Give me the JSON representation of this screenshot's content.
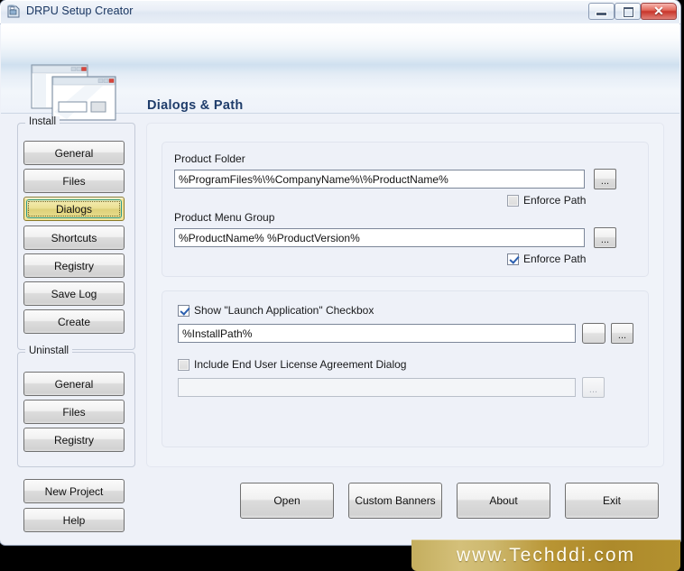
{
  "window": {
    "title": "DRPU Setup Creator",
    "app_icon": "setup-app-icon",
    "controls": {
      "minimize": "minimize-icon",
      "maximize": "maximize-icon",
      "close": "✕"
    }
  },
  "banner": {
    "title": "Dialogs & Path",
    "artwork": "dialog-windows-illustration"
  },
  "sidebar": {
    "install": {
      "legend": "Install",
      "items": [
        {
          "label": "General",
          "selected": false
        },
        {
          "label": "Files",
          "selected": false
        },
        {
          "label": "Dialogs",
          "selected": true
        },
        {
          "label": "Shortcuts",
          "selected": false
        },
        {
          "label": "Registry",
          "selected": false
        },
        {
          "label": "Save Log",
          "selected": false
        },
        {
          "label": "Create",
          "selected": false
        }
      ]
    },
    "uninstall": {
      "legend": "Uninstall",
      "items": [
        {
          "label": "General"
        },
        {
          "label": "Files"
        },
        {
          "label": "Registry"
        }
      ]
    },
    "extra": [
      {
        "label": "New Project"
      },
      {
        "label": "Help"
      }
    ]
  },
  "main": {
    "paths": {
      "product_folder": {
        "label": "Product Folder",
        "value": "%ProgramFiles%\\%CompanyName%\\%ProductName%",
        "placeholder": "",
        "browse_label": "...",
        "enforce": {
          "label": "Enforce Path",
          "checked": false
        }
      },
      "product_menu_group": {
        "label": "Product Menu Group",
        "value": "%ProductName% %ProductVersion%",
        "placeholder": "",
        "browse_label": "...",
        "enforce": {
          "label": "Enforce Path",
          "checked": true
        }
      }
    },
    "dialogs": {
      "launch": {
        "label": "Show \"Launch Application\" Checkbox",
        "checked": true,
        "value": "%InstallPath%",
        "placeholder": "",
        "pick_label": "",
        "browse_label": "..."
      },
      "eula": {
        "label": "Include End User License Agreement Dialog",
        "checked": false,
        "value": "",
        "placeholder": "",
        "browse_label": "..."
      }
    }
  },
  "actions": [
    {
      "label": "Open"
    },
    {
      "label": "Custom Banners"
    },
    {
      "label": "About"
    },
    {
      "label": "Exit"
    }
  ],
  "watermark": {
    "text": "www.Techddi.com"
  },
  "colors": {
    "background": "#eef1f8",
    "accent_title": "#1f3d6b",
    "selected_button": "#e9dd8d",
    "selected_border": "#2e9b8e",
    "close_button": "#c8352b",
    "watermark": "#b89433",
    "checkbox_check": "#2b5fb0"
  }
}
